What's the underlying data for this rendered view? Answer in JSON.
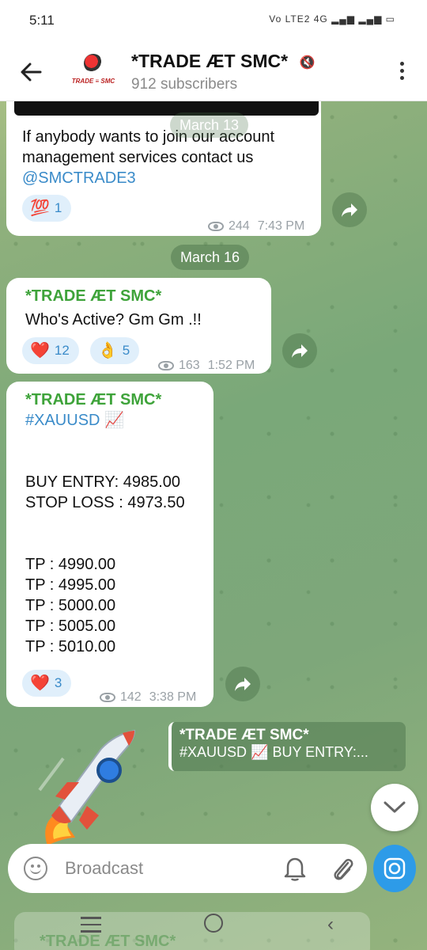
{
  "status_bar": {
    "time": "5:11",
    "indicators": "Vo LTE2 4G"
  },
  "header": {
    "channel_name": "*TRADE ÆT SMC*",
    "subscribers": "912 subscribers",
    "avatar_text": "TRADE ≡ SMC"
  },
  "messages": [
    {
      "text_line1": "If anybody wants to join our account",
      "text_line2": "management services contact us",
      "link": "@SMCTRADE3",
      "reactions": [
        {
          "emoji": "💯",
          "count": "1"
        }
      ],
      "views": "244",
      "time": "7:43 PM"
    },
    {
      "sender": "*TRADE ÆT SMC*",
      "text": "Who's Active? Gm Gm .!!",
      "reactions": [
        {
          "emoji": "❤️",
          "count": "12"
        },
        {
          "emoji": "👌",
          "count": "5"
        }
      ],
      "views": "163",
      "time": "1:52 PM"
    },
    {
      "sender": "*TRADE ÆT SMC*",
      "hashtag": "#XAUUSD",
      "hashtag_emoji": "📈",
      "entry": "BUY ENTRY: 4985.00",
      "stop_loss": "STOP LOSS : 4973.50",
      "tps": [
        "TP : 4990.00",
        "TP : 4995.00",
        "TP : 5000.00",
        "TP : 5005.00",
        "TP : 5010.00"
      ],
      "reactions": [
        {
          "emoji": "❤️",
          "count": "3"
        }
      ],
      "views": "142",
      "time": "3:38 PM"
    }
  ],
  "date_chips": [
    "March 13",
    "March 16"
  ],
  "reply_preview": {
    "title": "*TRADE ÆT SMC*",
    "text": "#XAUUSD 📈   BUY ENTRY:..."
  },
  "input": {
    "placeholder": "Broadcast"
  },
  "ghost_text": "*TRADE ÆT SMC*"
}
